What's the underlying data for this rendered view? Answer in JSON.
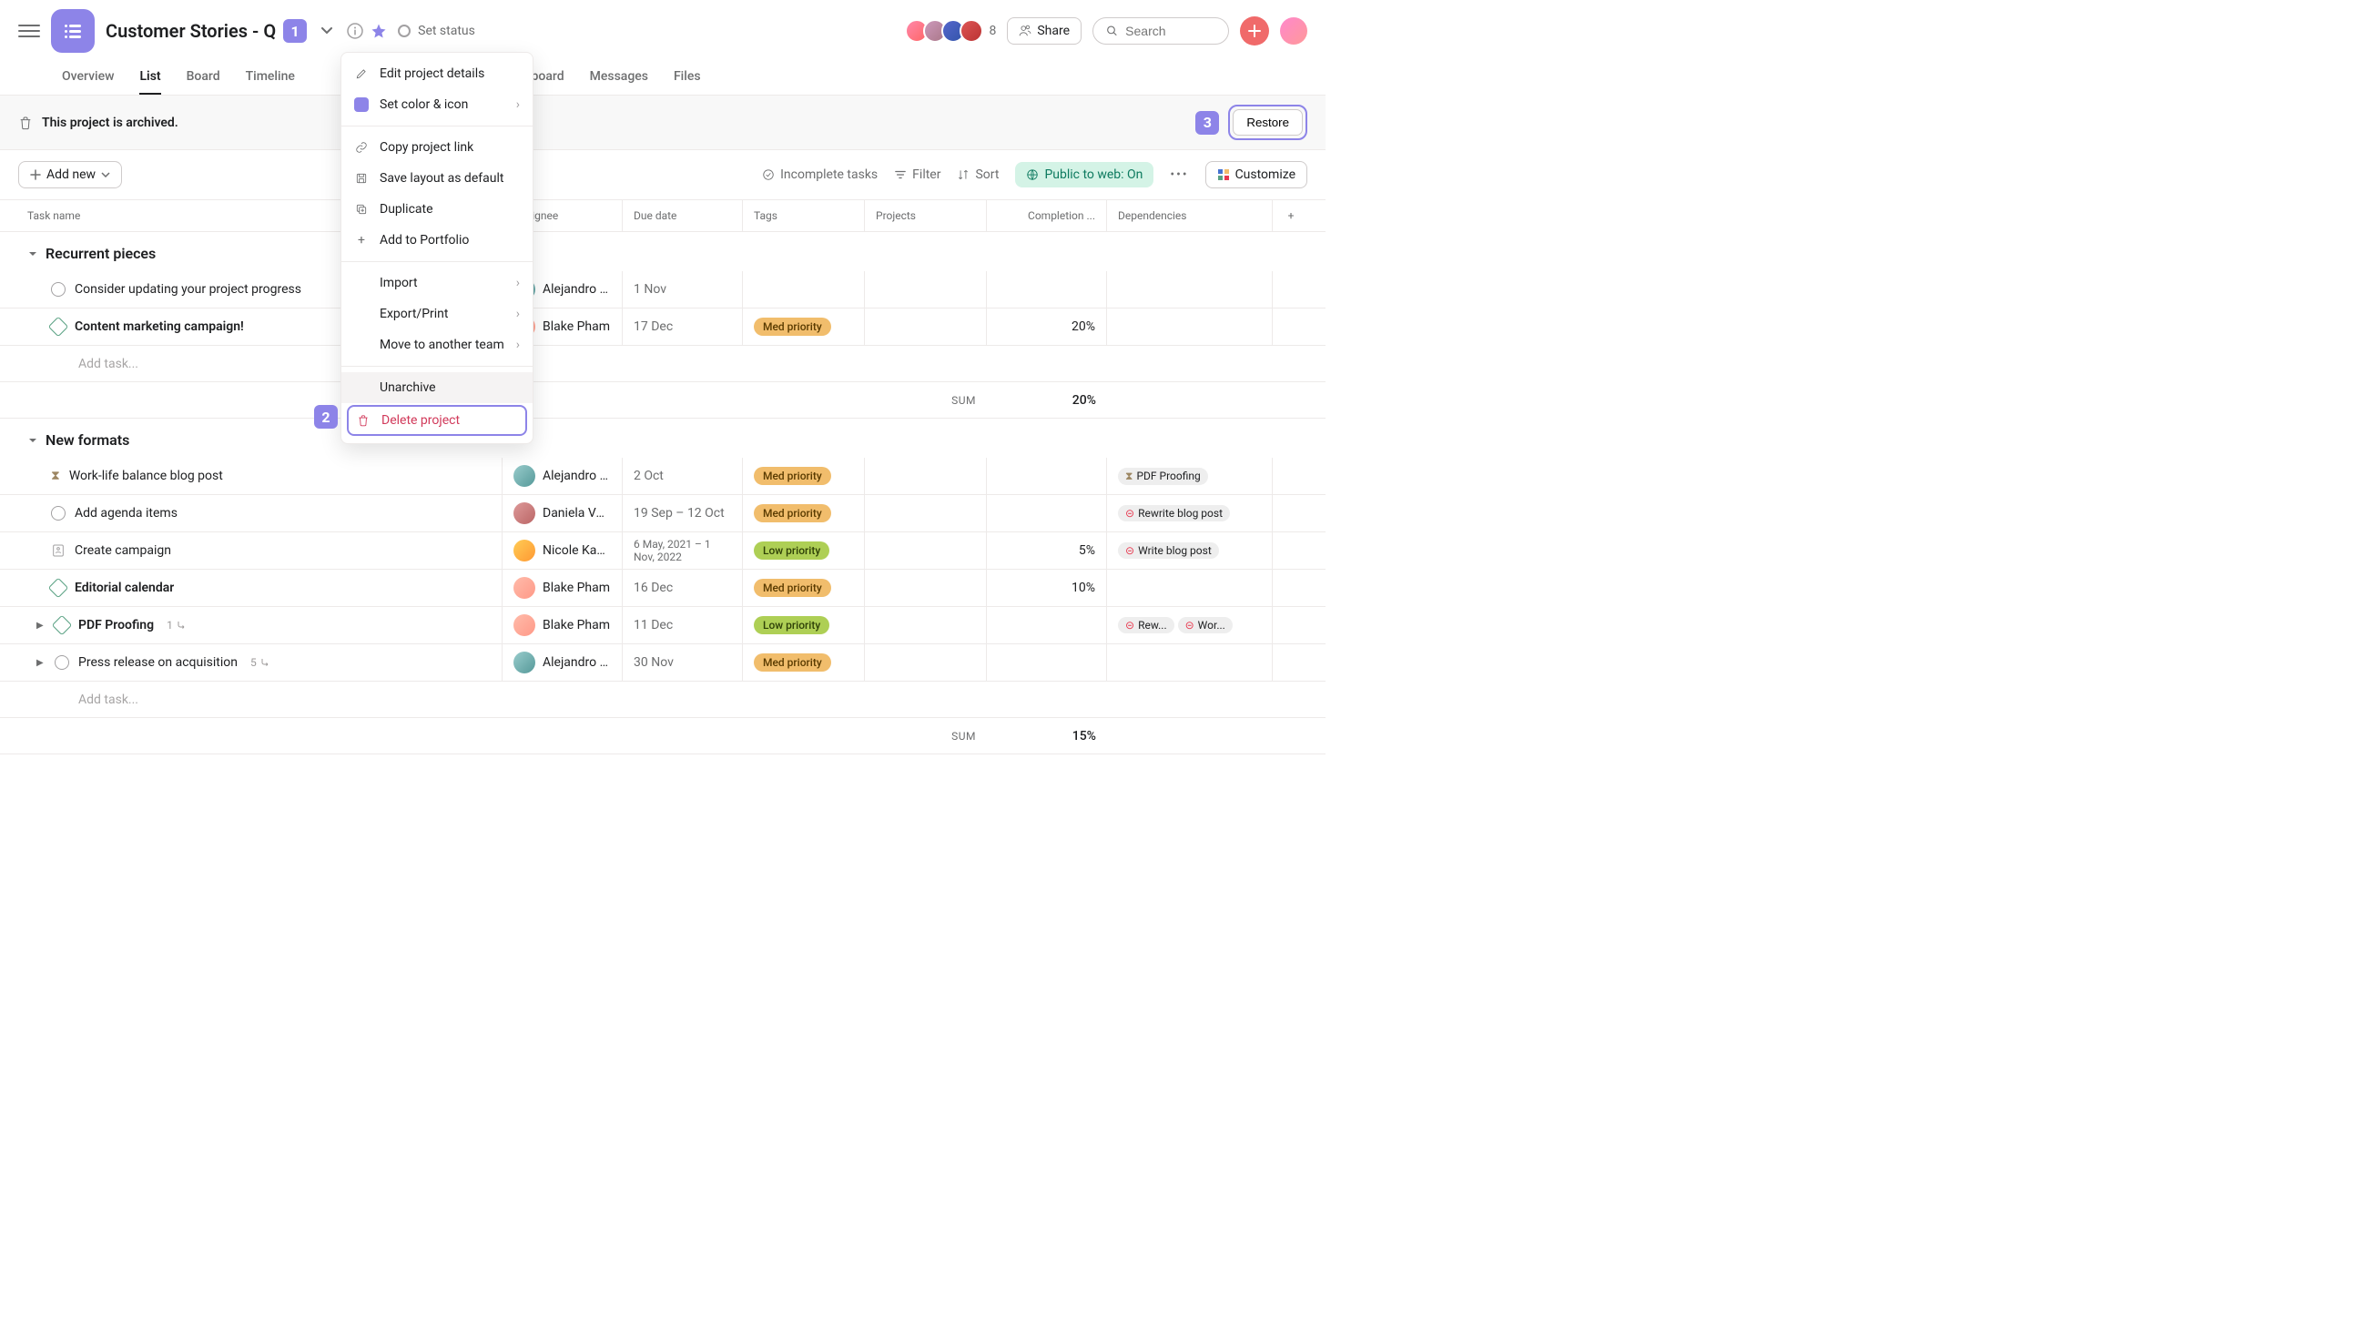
{
  "header": {
    "project_title": "Customer Stories - Q",
    "set_status": "Set status",
    "member_count": "8",
    "share": "Share",
    "search_placeholder": "Search",
    "badge1": "1"
  },
  "tabs": {
    "overview": "Overview",
    "list": "List",
    "board": "Board",
    "timeline": "Timeline",
    "dashboard": "Dashboard",
    "messages": "Messages",
    "files": "Files"
  },
  "archived": {
    "message": "This project is archived.",
    "badge3": "3",
    "restore": "Restore"
  },
  "toolbar": {
    "add_new": "Add new",
    "incomplete": "Incomplete tasks",
    "filter": "Filter",
    "sort": "Sort",
    "public": "Public to web: On",
    "customize": "Customize"
  },
  "columns": {
    "task": "Task name",
    "assignee": "Assignee",
    "due": "Due date",
    "tags": "Tags",
    "projects": "Projects",
    "completion": "Completion ...",
    "deps": "Dependencies"
  },
  "dropdown": {
    "edit": "Edit project details",
    "color": "Set color & icon",
    "copy": "Copy project link",
    "layout": "Save layout as default",
    "duplicate": "Duplicate",
    "portfolio": "Add to Portfolio",
    "import": "Import",
    "export": "Export/Print",
    "move": "Move to another team",
    "unarchive": "Unarchive",
    "delete": "Delete project",
    "badge2": "2"
  },
  "section1": {
    "title": "Recurrent pieces",
    "row1": {
      "task": "Consider updating your project progress",
      "assignee": "Alejandro L...",
      "due": "1 Nov"
    },
    "row2": {
      "task": "Content marketing campaign!",
      "assignee": "Blake Pham",
      "due": "17 Dec",
      "tag": "Med priority",
      "completion": "20%"
    },
    "add": "Add task...",
    "sum_label": "SUM",
    "sum_val": "20%"
  },
  "section2": {
    "title": "New formats",
    "row1": {
      "task": "Work-life balance blog post",
      "assignee": "Alejandro L...",
      "due": "2 Oct",
      "tag": "Med priority",
      "dep1": "PDF Proofing"
    },
    "row2": {
      "task": "Add agenda items",
      "assignee": "Daniela Var...",
      "due": "19 Sep – 12 Oct",
      "tag": "Med priority",
      "dep1": "Rewrite blog post"
    },
    "row3": {
      "task": "Create campaign",
      "assignee": "Nicole Kap...",
      "due": "6 May, 2021 – 1 Nov, 2022",
      "tag": "Low priority",
      "completion": "5%",
      "dep1": "Write blog post"
    },
    "row4": {
      "task": "Editorial calendar",
      "assignee": "Blake Pham",
      "due": "16 Dec",
      "tag": "Med priority",
      "completion": "10%"
    },
    "row5": {
      "task": "PDF Proofing",
      "sub": "1",
      "assignee": "Blake Pham",
      "due": "11 Dec",
      "tag": "Low priority",
      "dep1": "Rew...",
      "dep2": "Wor..."
    },
    "row6": {
      "task": "Press release on acquisition",
      "sub": "5",
      "assignee": "Alejandro L...",
      "due": "30 Nov",
      "tag": "Med priority"
    },
    "add": "Add task...",
    "sum_label": "SUM",
    "sum_val": "15%"
  }
}
